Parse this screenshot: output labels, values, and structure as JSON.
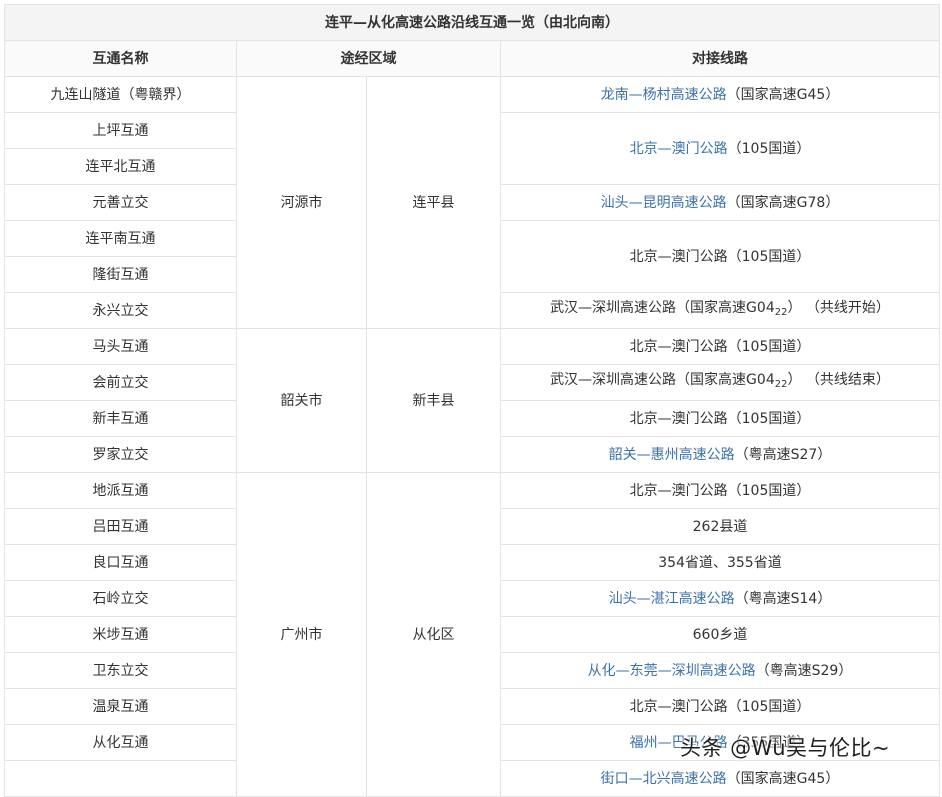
{
  "table": {
    "caption": "连平—从化高速公路沿线互通一览（由北向南）",
    "headers": {
      "name": "互通名称",
      "region": "途经区域",
      "connection": "对接线路"
    }
  },
  "groups": [
    {
      "city": "河源市",
      "district": "连平县"
    },
    {
      "city": "韶关市",
      "district": "新丰县"
    },
    {
      "city": "广州市",
      "district": "从化区"
    }
  ],
  "interchanges": [
    "九连山隧道（粤赣界）",
    "上坪互通",
    "连平北互通",
    "元善立交",
    "连平南互通",
    "隆街互通",
    "永兴立交",
    "马头互通",
    "会前立交",
    "新丰互通",
    "罗家立交",
    "地派互通",
    "吕田互通",
    "良口互通",
    "石岭立交",
    "米埗互通",
    "卫东立交",
    "温泉互通",
    "从化互通",
    ""
  ],
  "connections": [
    {
      "link": "龙南—杨村高速公路",
      "note": "（国家高速G45）"
    },
    {
      "link": "北京—澳门公路",
      "note": "（105国道）"
    },
    {
      "link": "汕头—昆明高速公路",
      "note": "（国家高速G78）"
    },
    {
      "text": "北京—澳门公路（105国道）"
    },
    {
      "pre": "武汉—深圳高速公路（国家高速G04",
      "sub": "22",
      "post": "） （共线开始）"
    },
    {
      "text": "北京—澳门公路（105国道）"
    },
    {
      "pre": "武汉—深圳高速公路（国家高速G04",
      "sub": "22",
      "post": "） （共线结束）"
    },
    {
      "text": "北京—澳门公路（105国道）"
    },
    {
      "link": "韶关—惠州高速公路",
      "note": "（粤高速S27）"
    },
    {
      "text": "北京—澳门公路（105国道）"
    },
    {
      "text": "262县道"
    },
    {
      "text": "354省道、355省道"
    },
    {
      "link": "汕头—湛江高速公路",
      "note": "（粤高速S14）"
    },
    {
      "text": "660乡道"
    },
    {
      "link": "从化—东莞—深圳高速公路",
      "note": "（粤高速S29）"
    },
    {
      "text": "北京—澳门公路（105国道）"
    },
    {
      "link": "福州—巴马公路",
      "note": "（355国道）"
    },
    {
      "link": "街口—北兴高速公路",
      "note": "（国家高速G45）"
    }
  ],
  "watermark": "头条 @Wu吴与伦比~"
}
